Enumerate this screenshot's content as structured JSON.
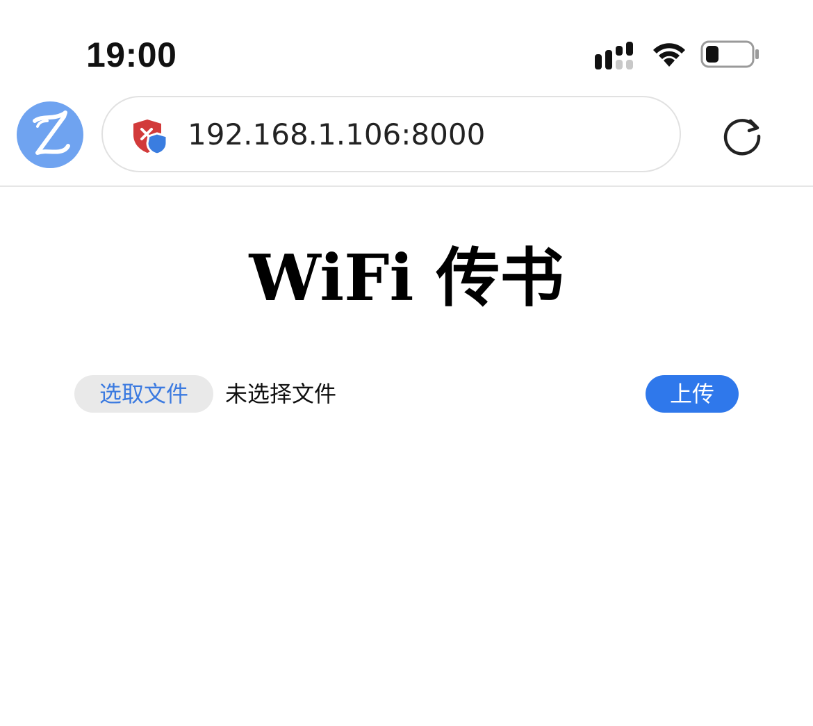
{
  "status_bar": {
    "time": "19:00",
    "icons": [
      "cellular-signal-icon",
      "wifi-icon",
      "battery-icon"
    ]
  },
  "browser": {
    "logo_letter": "Z",
    "url": "192.168.1.106:8000",
    "security_icon": "shield-warning-icon",
    "reload_icon": "reload-icon"
  },
  "page": {
    "title": "WiFi 传书",
    "choose_file_label": "选取文件",
    "no_file_text": "未选择文件",
    "upload_label": "上传"
  },
  "colors": {
    "accent": "#2f78eb",
    "link": "#3b7ae0",
    "logo": "#6fa3f0",
    "shield_red": "#d23a3a",
    "shield_blue": "#3a7de0"
  }
}
